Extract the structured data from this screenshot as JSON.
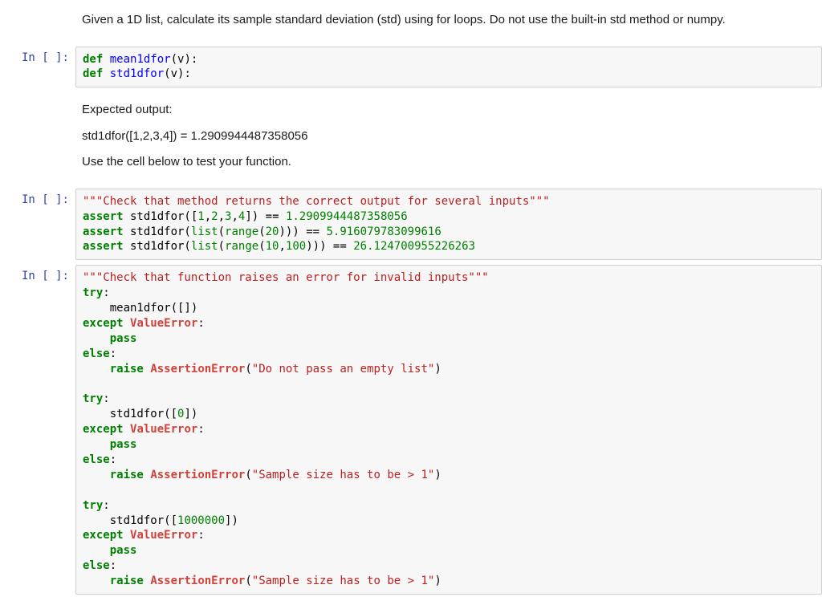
{
  "cells": [
    {
      "type": "markdown",
      "text": "Given a 1D list, calculate its sample standard deviation (std) using for loops. Do not use the built-in std method or numpy."
    },
    {
      "type": "code",
      "prompt": "In [ ]:",
      "raw": "def mean1dfor(v):\ndef std1dfor(v):",
      "tokens": [
        [
          {
            "c": "k",
            "t": "def"
          },
          {
            "c": "n",
            "t": " "
          },
          {
            "c": "nf",
            "t": "mean1dfor"
          },
          {
            "c": "n",
            "t": "(v):"
          }
        ],
        [
          {
            "c": "k",
            "t": "def"
          },
          {
            "c": "n",
            "t": " "
          },
          {
            "c": "nf",
            "t": "std1dfor"
          },
          {
            "c": "n",
            "t": "(v):"
          }
        ]
      ]
    },
    {
      "type": "markdown",
      "lines": [
        "Expected output:",
        "std1dfor([1,2,3,4]) = 1.2909944487358056",
        "Use the cell below to test your function."
      ]
    },
    {
      "type": "code",
      "prompt": "In [ ]:",
      "raw": "\"\"\"Check that method returns the correct output for several inputs\"\"\"\nassert std1dfor([1,2,3,4]) == 1.2909944487358056\nassert std1dfor(list(range(20))) == 5.916079783099616\nassert std1dfor(list(range(10,100))) == 26.124700955226263",
      "tokens": [
        [
          {
            "c": "s",
            "t": "\"\"\"Check that method returns the correct output for several inputs\"\"\""
          }
        ],
        [
          {
            "c": "k",
            "t": "assert"
          },
          {
            "c": "n",
            "t": " std1dfor(["
          },
          {
            "c": "m",
            "t": "1"
          },
          {
            "c": "n",
            "t": ","
          },
          {
            "c": "m",
            "t": "2"
          },
          {
            "c": "n",
            "t": ","
          },
          {
            "c": "m",
            "t": "3"
          },
          {
            "c": "n",
            "t": ","
          },
          {
            "c": "m",
            "t": "4"
          },
          {
            "c": "n",
            "t": "]) == "
          },
          {
            "c": "m",
            "t": "1.2909944487358056"
          }
        ],
        [
          {
            "c": "k",
            "t": "assert"
          },
          {
            "c": "n",
            "t": " std1dfor("
          },
          {
            "c": "bi",
            "t": "list"
          },
          {
            "c": "n",
            "t": "("
          },
          {
            "c": "bi",
            "t": "range"
          },
          {
            "c": "n",
            "t": "("
          },
          {
            "c": "m",
            "t": "20"
          },
          {
            "c": "n",
            "t": "))) == "
          },
          {
            "c": "m",
            "t": "5.916079783099616"
          }
        ],
        [
          {
            "c": "k",
            "t": "assert"
          },
          {
            "c": "n",
            "t": " std1dfor("
          },
          {
            "c": "bi",
            "t": "list"
          },
          {
            "c": "n",
            "t": "("
          },
          {
            "c": "bi",
            "t": "range"
          },
          {
            "c": "n",
            "t": "("
          },
          {
            "c": "m",
            "t": "10"
          },
          {
            "c": "n",
            "t": ","
          },
          {
            "c": "m",
            "t": "100"
          },
          {
            "c": "n",
            "t": "))) == "
          },
          {
            "c": "m",
            "t": "26.124700955226263"
          }
        ]
      ]
    },
    {
      "type": "code",
      "selected": true,
      "prompt": "In [ ]:",
      "raw": "\"\"\"Check that function raises an error for invalid inputs\"\"\"\ntry:\n    mean1dfor([])\nexcept ValueError:\n    pass\nelse:\n    raise AssertionError(\"Do not pass an empty list\")\n\ntry:\n    std1dfor([0])\nexcept ValueError:\n    pass\nelse:\n    raise AssertionError(\"Sample size has to be > 1\")\n\ntry:\n    std1dfor([1000000])\nexcept ValueError:\n    pass\nelse:\n    raise AssertionError(\"Sample size has to be > 1\")",
      "tokens": [
        [
          {
            "c": "s",
            "t": "\"\"\"Check that function raises an error for invalid inputs\"\"\""
          }
        ],
        [
          {
            "c": "k",
            "t": "try"
          },
          {
            "c": "n",
            "t": ":"
          }
        ],
        [
          {
            "c": "n",
            "t": "    mean1dfor([])"
          }
        ],
        [
          {
            "c": "k",
            "t": "except"
          },
          {
            "c": "n",
            "t": " "
          },
          {
            "c": "exc",
            "t": "ValueError"
          },
          {
            "c": "n",
            "t": ":"
          }
        ],
        [
          {
            "c": "n",
            "t": "    "
          },
          {
            "c": "k",
            "t": "pass"
          }
        ],
        [
          {
            "c": "k",
            "t": "else"
          },
          {
            "c": "n",
            "t": ":"
          }
        ],
        [
          {
            "c": "n",
            "t": "    "
          },
          {
            "c": "k",
            "t": "raise"
          },
          {
            "c": "n",
            "t": " "
          },
          {
            "c": "exc",
            "t": "AssertionError"
          },
          {
            "c": "n",
            "t": "("
          },
          {
            "c": "s",
            "t": "\"Do not pass an empty list\""
          },
          {
            "c": "n",
            "t": ")"
          }
        ],
        [
          {
            "c": "n",
            "t": ""
          }
        ],
        [
          {
            "c": "k",
            "t": "try"
          },
          {
            "c": "n",
            "t": ":"
          }
        ],
        [
          {
            "c": "n",
            "t": "    std1dfor(["
          },
          {
            "c": "m",
            "t": "0"
          },
          {
            "c": "n",
            "t": "])"
          }
        ],
        [
          {
            "c": "k",
            "t": "except"
          },
          {
            "c": "n",
            "t": " "
          },
          {
            "c": "exc",
            "t": "ValueError"
          },
          {
            "c": "n",
            "t": ":"
          }
        ],
        [
          {
            "c": "n",
            "t": "    "
          },
          {
            "c": "k",
            "t": "pass"
          }
        ],
        [
          {
            "c": "k",
            "t": "else"
          },
          {
            "c": "n",
            "t": ":"
          }
        ],
        [
          {
            "c": "n",
            "t": "    "
          },
          {
            "c": "k",
            "t": "raise"
          },
          {
            "c": "n",
            "t": " "
          },
          {
            "c": "exc",
            "t": "AssertionError"
          },
          {
            "c": "n",
            "t": "("
          },
          {
            "c": "s",
            "t": "\"Sample size has to be > 1\""
          },
          {
            "c": "n",
            "t": ")"
          }
        ],
        [
          {
            "c": "n",
            "t": ""
          }
        ],
        [
          {
            "c": "k",
            "t": "try"
          },
          {
            "c": "n",
            "t": ":"
          }
        ],
        [
          {
            "c": "n",
            "t": "    std1dfor(["
          },
          {
            "c": "m",
            "t": "1000000"
          },
          {
            "c": "n",
            "t": "])"
          }
        ],
        [
          {
            "c": "k",
            "t": "except"
          },
          {
            "c": "n",
            "t": " "
          },
          {
            "c": "exc",
            "t": "ValueError"
          },
          {
            "c": "n",
            "t": ":"
          }
        ],
        [
          {
            "c": "n",
            "t": "    "
          },
          {
            "c": "k",
            "t": "pass"
          }
        ],
        [
          {
            "c": "k",
            "t": "else"
          },
          {
            "c": "n",
            "t": ":"
          }
        ],
        [
          {
            "c": "n",
            "t": "    "
          },
          {
            "c": "k",
            "t": "raise"
          },
          {
            "c": "n",
            "t": " "
          },
          {
            "c": "exc",
            "t": "AssertionError"
          },
          {
            "c": "n",
            "t": "("
          },
          {
            "c": "s",
            "t": "\"Sample size has to be > 1\""
          },
          {
            "c": "n",
            "t": ")"
          }
        ]
      ]
    }
  ]
}
